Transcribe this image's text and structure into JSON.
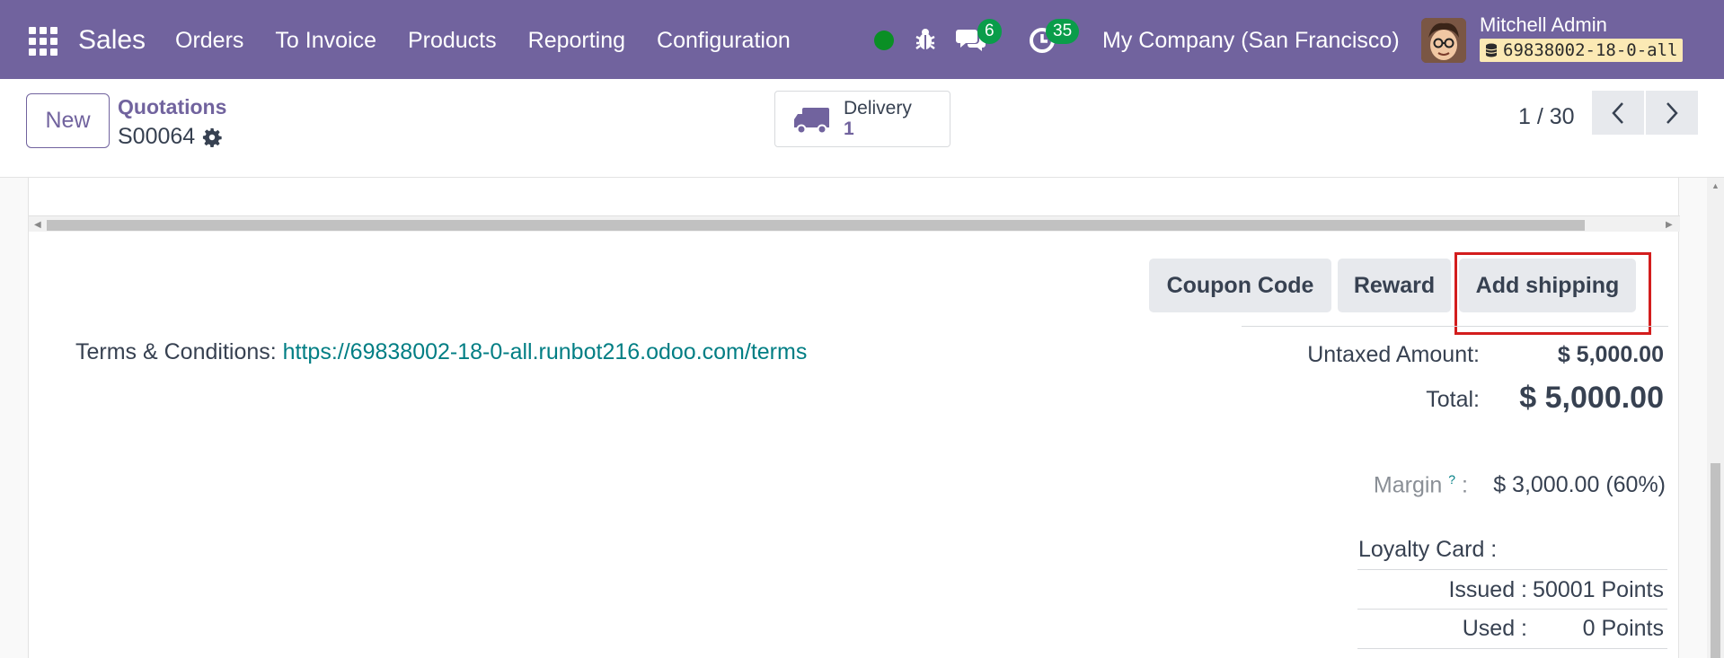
{
  "navbar": {
    "app_name": "Sales",
    "menu": [
      "Orders",
      "To Invoice",
      "Products",
      "Reporting",
      "Configuration"
    ],
    "messages_count": "6",
    "activities_count": "35",
    "company": "My Company (San Francisco)",
    "user_name": "Mitchell Admin",
    "database": "69838002-18-0-all",
    "colors": {
      "bar": "#71639e",
      "presence": "#0a8f25",
      "badge": "#0a9d4a"
    }
  },
  "control": {
    "new_label": "New",
    "breadcrumb_parent": "Quotations",
    "record_name": "S00064",
    "smart_button": {
      "label": "Delivery",
      "value": "1",
      "icon": "truck-icon"
    },
    "pager": "1 / 30"
  },
  "actions": {
    "coupon": "Coupon Code",
    "reward": "Reward",
    "shipping": "Add shipping"
  },
  "terms": {
    "label": "Terms & Conditions: ",
    "link": "https://69838002-18-0-all.runbot216.odoo.com/terms"
  },
  "totals": {
    "untaxed_label": "Untaxed Amount:",
    "untaxed_value": "$ 5,000.00",
    "total_label": "Total:",
    "total_value": "$ 5,000.00",
    "margin_label": "Margin",
    "margin_help": "?",
    "margin_colon": ":",
    "margin_value": "$ 3,000.00 (60%)"
  },
  "loyalty": {
    "title": "Loyalty Card :",
    "issued_label": "Issued :",
    "issued_value": "50001 Points",
    "used_label": "Used :",
    "used_value": "0 Points"
  }
}
